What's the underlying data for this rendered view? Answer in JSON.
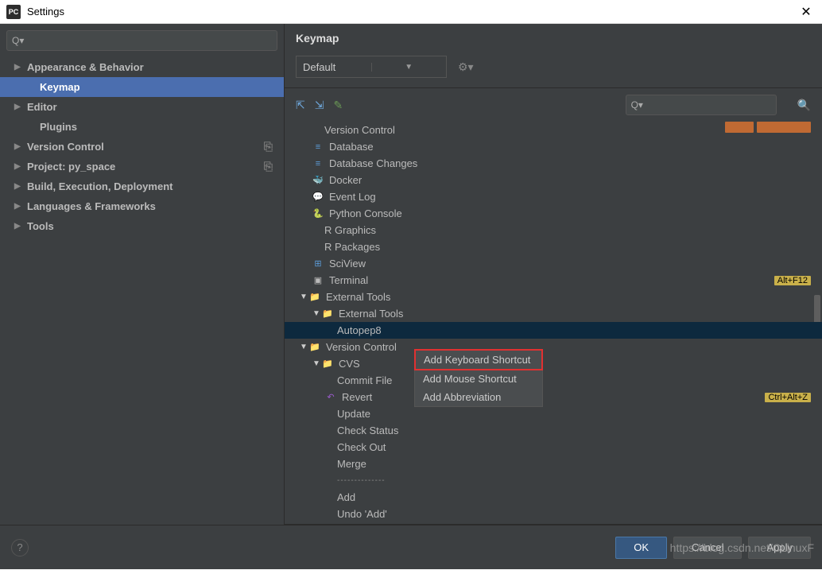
{
  "window": {
    "title": "Settings",
    "icon_text": "PC"
  },
  "sidebar": {
    "search_placeholder": "",
    "items": [
      {
        "label": "Appearance & Behavior",
        "bold": true,
        "arrow": "▶"
      },
      {
        "label": "Keymap",
        "bold": true,
        "selected": true,
        "indent": true
      },
      {
        "label": "Editor",
        "bold": true,
        "arrow": "▶"
      },
      {
        "label": "Plugins",
        "bold": true,
        "indent": true
      },
      {
        "label": "Version Control",
        "bold": true,
        "arrow": "▶",
        "badge": "⎘"
      },
      {
        "label": "Project: py_space",
        "bold": true,
        "arrow": "▶",
        "badge": "⎘"
      },
      {
        "label": "Build, Execution, Deployment",
        "bold": true,
        "arrow": "▶"
      },
      {
        "label": "Languages & Frameworks",
        "bold": true,
        "arrow": "▶"
      },
      {
        "label": "Tools",
        "bold": true,
        "arrow": "▶"
      }
    ]
  },
  "main": {
    "title": "Keymap",
    "scheme": "Default"
  },
  "tree": [
    {
      "label": "Version Control",
      "ind": "ind0a",
      "icon": "",
      "cut": true
    },
    {
      "label": "Database",
      "ind": "ind1",
      "icon": "≡",
      "iclass": "ico-db"
    },
    {
      "label": "Database Changes",
      "ind": "ind1",
      "icon": "≡",
      "iclass": "ico-db"
    },
    {
      "label": "Docker",
      "ind": "ind1",
      "icon": "🐳",
      "iclass": "ico-docker"
    },
    {
      "label": "Event Log",
      "ind": "ind1",
      "icon": "💬",
      "iclass": "ico-log"
    },
    {
      "label": "Python Console",
      "ind": "ind1",
      "icon": "🐍",
      "iclass": "ico-py"
    },
    {
      "label": "R Graphics",
      "ind": "ind2"
    },
    {
      "label": "R Packages",
      "ind": "ind2"
    },
    {
      "label": "SciView",
      "ind": "ind1",
      "icon": "⊞",
      "iclass": "ico-grid"
    },
    {
      "label": "Terminal",
      "ind": "ind1",
      "icon": "▣",
      "iclass": "ico-term",
      "shortcut": "Alt+F12"
    },
    {
      "label": "External Tools",
      "ind": "ind0",
      "arrow": "▼",
      "icon": "📁",
      "iclass": "ico-folder"
    },
    {
      "label": "External Tools",
      "ind": "ind1",
      "arrow": "▼",
      "icon": "📁",
      "iclass": "ico-folder"
    },
    {
      "label": "Autopep8",
      "ind": "ind3",
      "selected": true
    },
    {
      "label": "Version Control",
      "ind": "ind0",
      "arrow": "▼",
      "icon": "📁",
      "iclass": "ico-folder"
    },
    {
      "label": "CVS",
      "ind": "ind1",
      "arrow": "▼",
      "icon": "📁",
      "iclass": "ico-folder"
    },
    {
      "label": "Commit File",
      "ind": "ind3"
    },
    {
      "label": "Revert",
      "ind": "ind2",
      "icon": "↶",
      "iclass": "ico-undo",
      "shortcut": "Ctrl+Alt+Z"
    },
    {
      "label": "Update",
      "ind": "ind3"
    },
    {
      "label": "Check Status",
      "ind": "ind3"
    },
    {
      "label": "Check Out",
      "ind": "ind3"
    },
    {
      "label": "Merge",
      "ind": "ind3"
    },
    {
      "label": "--------------",
      "ind": "ind3",
      "sep": true
    },
    {
      "label": "Add",
      "ind": "ind3"
    },
    {
      "label": "Undo 'Add'",
      "ind": "ind3"
    }
  ],
  "context_menu": [
    "Add Keyboard Shortcut",
    "Add Mouse Shortcut",
    "Add Abbreviation"
  ],
  "footer": {
    "ok": "OK",
    "cancel": "Cancel",
    "apply": "Apply",
    "help": "?"
  },
  "watermark": "https://blog.csdn.net/CLinuxF"
}
